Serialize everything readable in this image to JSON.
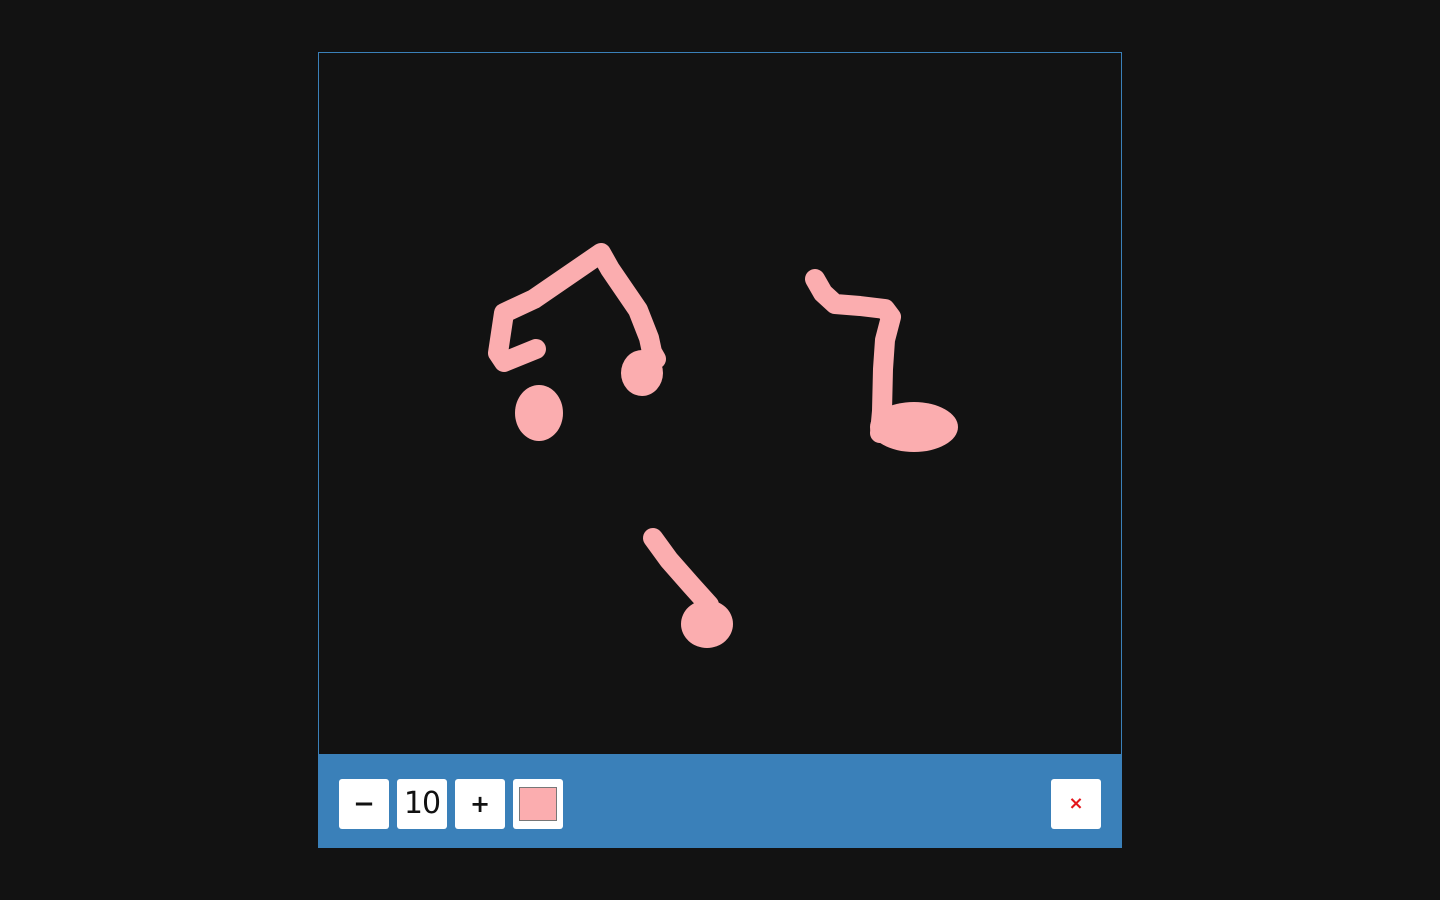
{
  "canvas": {
    "stroke_color": "#fbadaf",
    "background_color": "#121212"
  },
  "toolbar": {
    "background_color": "#3a80b9",
    "decrease_label": "−",
    "brush_size": "10",
    "increase_label": "+",
    "current_color": "#fbadaf",
    "clear_label": "×",
    "clear_color": "#e4161c"
  }
}
